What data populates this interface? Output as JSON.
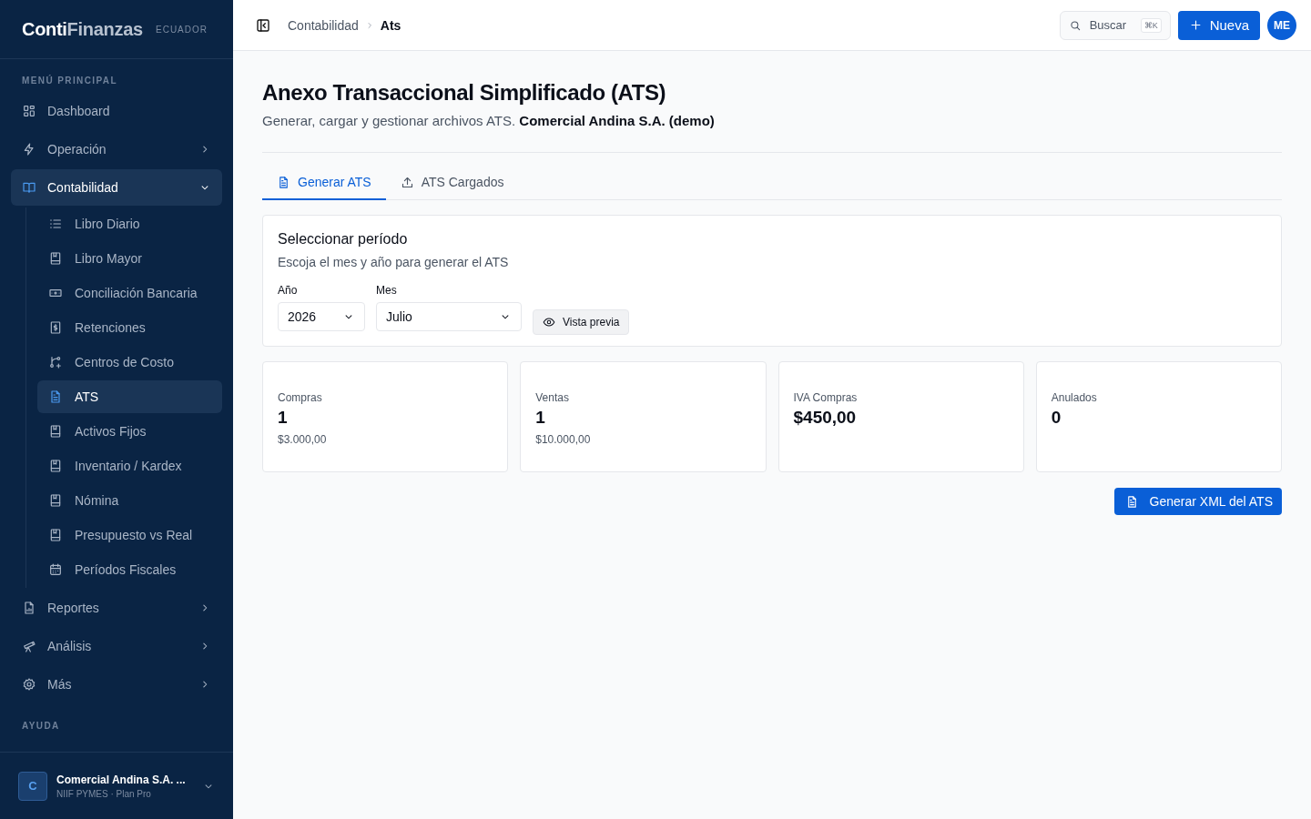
{
  "sidebar": {
    "logo": {
      "first": "Conti",
      "second": "Finanzas"
    },
    "region": "ECUADOR",
    "section": "MENÚ PRINCIPAL",
    "items": [
      {
        "label": "Dashboard",
        "kind": "grid",
        "selected": false
      },
      {
        "label": "Operación",
        "kind": "bolt",
        "selected": false,
        "expanded": false
      },
      {
        "label": "Contabilidad",
        "kind": "book",
        "selected": true,
        "expanded": true,
        "children": [
          {
            "label": "Libro Diario",
            "kind": "list",
            "selected": false
          },
          {
            "label": "Libro Mayor",
            "kind": "ledger",
            "selected": false
          },
          {
            "label": "Conciliación Bancaria",
            "kind": "cash",
            "selected": false
          },
          {
            "label": "Retenciones",
            "kind": "receipt",
            "selected": false
          },
          {
            "label": "Centros de Costo",
            "kind": "branch",
            "selected": false
          },
          {
            "label": "ATS",
            "kind": "sheet",
            "selected": true
          },
          {
            "label": "Activos Fijos",
            "kind": "ledger",
            "selected": false
          },
          {
            "label": "Inventario / Kardex",
            "kind": "ledger",
            "selected": false
          },
          {
            "label": "Nómina",
            "kind": "ledger",
            "selected": false
          },
          {
            "label": "Presupuesto vs Real",
            "kind": "ledger",
            "selected": false
          },
          {
            "label": "Períodos Fiscales",
            "kind": "calendar",
            "selected": false
          }
        ]
      },
      {
        "label": "Reportes",
        "kind": "report",
        "selected": false,
        "expanded": false
      },
      {
        "label": "Análisis",
        "kind": "telescope",
        "selected": false,
        "expanded": false
      },
      {
        "label": "Más",
        "kind": "gear",
        "selected": false,
        "expanded": false
      }
    ],
    "help_section": "AYUDA",
    "company": {
      "initial": "C",
      "name": "Comercial Andina S.A. ...",
      "plan": "NIIF PYMES · Plan Pro"
    }
  },
  "topbar": {
    "breadcrumbs": [
      "Contabilidad",
      "Ats"
    ],
    "search": {
      "placeholder": "Buscar",
      "shortcut": "⌘K"
    },
    "new_button": "Nueva",
    "avatar": "ME"
  },
  "page": {
    "title": "Anexo Transaccional Simplificado (ATS)",
    "subtitle": "Generar, cargar y gestionar archivos ATS. **Comercial Andina S.A. (demo)**",
    "tabs": [
      {
        "label": "Generar ATS",
        "kind": "sheet",
        "selected": true
      },
      {
        "label": "ATS Cargados",
        "kind": "upload",
        "selected": false
      }
    ],
    "period": {
      "title": "Seleccionar período",
      "description": "Escoja el mes y año para generar el ATS",
      "fields": [
        {
          "label": "Año",
          "value": "2026"
        },
        {
          "label": "Mes",
          "value": "Julio"
        }
      ],
      "preview_button": "Vista previa"
    },
    "stats": [
      {
        "label": "Compras",
        "value": "1",
        "amount": "$3.000,00"
      },
      {
        "label": "Ventas",
        "value": "1",
        "amount": "$10.000,00"
      },
      {
        "label": "IVA Compras",
        "value": "$450,00"
      },
      {
        "label": "Anulados",
        "value": "0"
      }
    ],
    "generate_button": "Generar XML del ATS"
  }
}
